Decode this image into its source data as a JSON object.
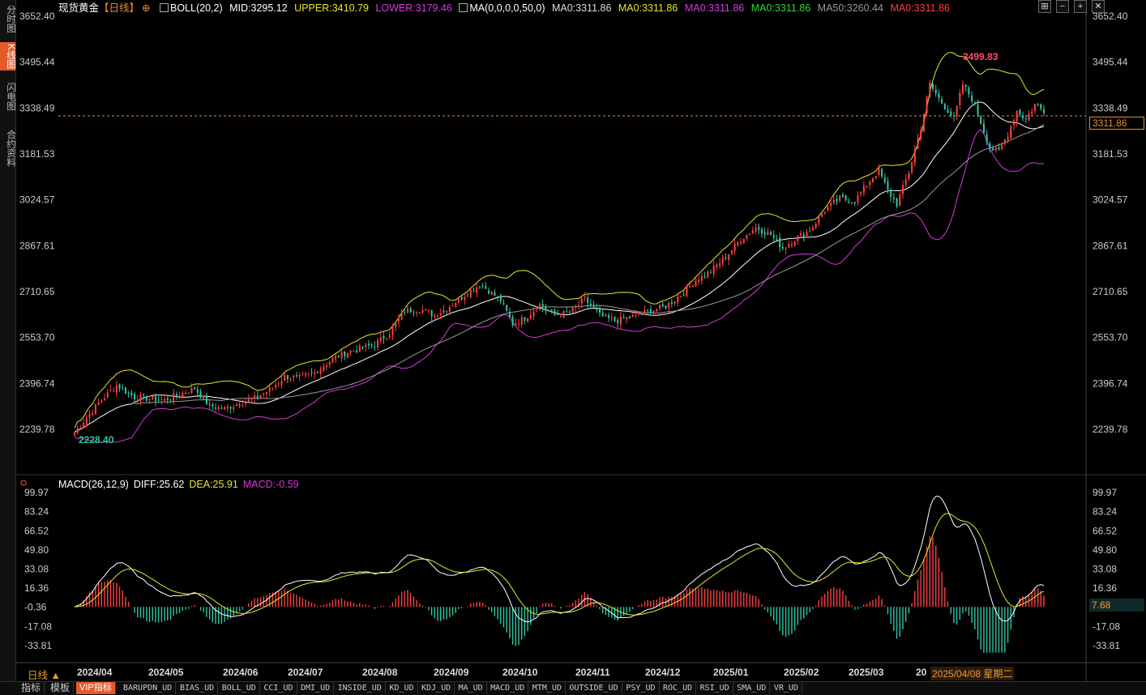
{
  "left_tabs": [
    {
      "label": "分时图",
      "active": false
    },
    {
      "label": "K线图",
      "active": true
    },
    {
      "label": "闪电图",
      "active": false
    },
    {
      "label": "合约资料",
      "active": false
    }
  ],
  "header": {
    "symbol": "现货黄金",
    "period_tag": "【日线】",
    "boll_name": "BOLL(20,2)",
    "mid": "MID:3295.12",
    "upper": "UPPER:3410.79",
    "lower": "LOWER:3179.46",
    "ma_name": "MA(0,0,0,0,50,0)",
    "ma_items": [
      {
        "text": "MA0:3311.86",
        "color": "#dddddd"
      },
      {
        "text": "MA0:3311.86",
        "color": "#e6e62e"
      },
      {
        "text": "MA0:3311.86",
        "color": "#d43adb"
      },
      {
        "text": "MA0:3311.86",
        "color": "#2fd62f"
      },
      {
        "text": "MA50:3260.44",
        "color": "#999999"
      },
      {
        "text": "MA0:3311.86",
        "color": "#ff3b3b"
      }
    ]
  },
  "toolbar": {
    "buttons": [
      "⊞",
      "−",
      "+",
      "✕"
    ]
  },
  "price_axis": {
    "labels": [
      "3652.40",
      "3495.44",
      "3338.49",
      "3181.53",
      "3024.57",
      "2867.61",
      "2710.65",
      "2553.70",
      "2396.74",
      "2239.78"
    ]
  },
  "macd_axis": {
    "labels": [
      "99.97",
      "83.24",
      "66.52",
      "49.80",
      "33.08",
      "16.36",
      "-0.36",
      "-17.08",
      "-33.81"
    ]
  },
  "current_price": "3311.86",
  "macd_current": "7.68",
  "high_annotation": "3499.83",
  "low_annotation": "2228.40",
  "macd_info": {
    "name": "MACD(26,12,9)",
    "diff": "DIFF:25.62",
    "dea": "DEA:25.91",
    "macd": "MACD:-0.59"
  },
  "x_axis": {
    "labels": [
      "2024/04",
      "2024/05",
      "2024/06",
      "2024/07",
      "2024/08",
      "2024/09",
      "2024/10",
      "2024/11",
      "2024/12",
      "2025/01",
      "2025/02",
      "2025/03",
      "20"
    ]
  },
  "period_label": "日线 ▲",
  "date_tooltip": "2025/04/08 星期二",
  "bottom_tabs": [
    "指标",
    "模板",
    "VIP指标",
    "BARUPDN_UD",
    "BIAS_UD",
    "BOLL_UD",
    "CCI_UD",
    "DMI_UD",
    "INSIDE_UD",
    "KD_UD",
    "KDJ_UD",
    "MA_UD",
    "MACD_UD",
    "MTM_UD",
    "OUTSIDE_UD",
    "PSY_UD",
    "ROC_UD",
    "RSI_UD",
    "SMA_UD",
    "VR_UD"
  ],
  "colors": {
    "up": "#ff4040",
    "down": "#2ec7a6",
    "mid": "#ffffff",
    "upper": "#e6e62e",
    "lower": "#d43adb",
    "ma50": "#999999",
    "dea": "#e6e62e",
    "diff": "#ffffff",
    "accent": "#e55a2b"
  },
  "chart_data": {
    "type": "candlestick",
    "price_range": [
      2200,
      3652.4
    ],
    "macd_range": [
      -40,
      100
    ],
    "anchors": [
      [
        0,
        2230
      ],
      [
        8,
        2330
      ],
      [
        14,
        2390
      ],
      [
        20,
        2350
      ],
      [
        30,
        2340
      ],
      [
        40,
        2380
      ],
      [
        45,
        2320
      ],
      [
        50,
        2310
      ],
      [
        55,
        2330
      ],
      [
        60,
        2345
      ],
      [
        65,
        2375
      ],
      [
        70,
        2420
      ],
      [
        75,
        2415
      ],
      [
        80,
        2435
      ],
      [
        86,
        2480
      ],
      [
        90,
        2500
      ],
      [
        95,
        2515
      ],
      [
        100,
        2530
      ],
      [
        105,
        2570
      ],
      [
        110,
        2645
      ],
      [
        115,
        2650
      ],
      [
        120,
        2630
      ],
      [
        125,
        2660
      ],
      [
        130,
        2700
      ],
      [
        135,
        2735
      ],
      [
        138,
        2715
      ],
      [
        142,
        2680
      ],
      [
        146,
        2600
      ],
      [
        150,
        2620
      ],
      [
        155,
        2665
      ],
      [
        160,
        2630
      ],
      [
        165,
        2640
      ],
      [
        170,
        2685
      ],
      [
        175,
        2630
      ],
      [
        180,
        2610
      ],
      [
        186,
        2625
      ],
      [
        192,
        2645
      ],
      [
        197,
        2660
      ],
      [
        202,
        2700
      ],
      [
        207,
        2750
      ],
      [
        212,
        2780
      ],
      [
        217,
        2830
      ],
      [
        222,
        2890
      ],
      [
        227,
        2930
      ],
      [
        232,
        2905
      ],
      [
        236,
        2860
      ],
      [
        240,
        2890
      ],
      [
        245,
        2920
      ],
      [
        250,
        2990
      ],
      [
        255,
        3030
      ],
      [
        260,
        3020
      ],
      [
        265,
        3090
      ],
      [
        268,
        3125
      ],
      [
        271,
        3055
      ],
      [
        274,
        3010
      ],
      [
        278,
        3120
      ],
      [
        282,
        3270
      ],
      [
        285,
        3420
      ],
      [
        288,
        3370
      ],
      [
        291,
        3330
      ],
      [
        293,
        3300
      ],
      [
        296,
        3420
      ],
      [
        299,
        3370
      ],
      [
        302,
        3290
      ],
      [
        305,
        3200
      ],
      [
        308,
        3190
      ],
      [
        311,
        3250
      ],
      [
        314,
        3330
      ],
      [
        317,
        3300
      ],
      [
        320,
        3350
      ],
      [
        323,
        3330
      ]
    ]
  }
}
